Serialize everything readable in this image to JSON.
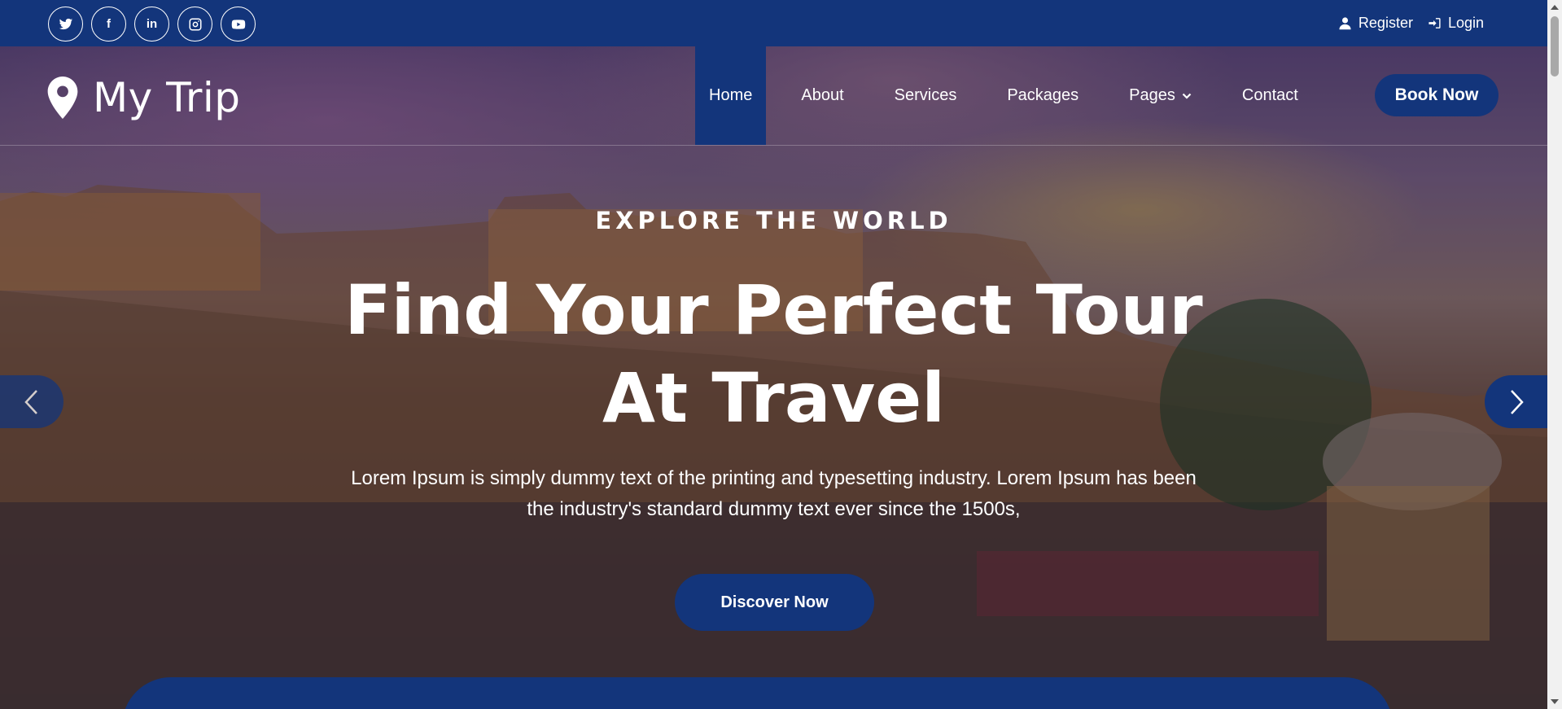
{
  "topbar": {
    "social": [
      {
        "icon": "twitter-icon"
      },
      {
        "icon": "facebook-icon",
        "glyph": "f"
      },
      {
        "icon": "linkedin-icon",
        "glyph": "in"
      },
      {
        "icon": "instagram-icon"
      },
      {
        "icon": "youtube-icon"
      }
    ],
    "register_label": "Register",
    "login_label": "Login"
  },
  "brand": {
    "name": "My Trip"
  },
  "nav": {
    "items": [
      "Home",
      "About",
      "Services",
      "Packages",
      "Pages",
      "Contact"
    ],
    "active": "Home",
    "book_label": "Book Now"
  },
  "hero": {
    "kicker": "EXPLORE THE WORLD",
    "title": "Find Your Perfect Tour At Travel",
    "description": "Lorem Ipsum is simply dummy text of the printing and typesetting industry. Lorem Ipsum has been the industry's standard dummy text ever since the 1500s,",
    "cta_label": "Discover Now"
  },
  "colors": {
    "primary": "#13357b",
    "text": "#ffffff"
  }
}
